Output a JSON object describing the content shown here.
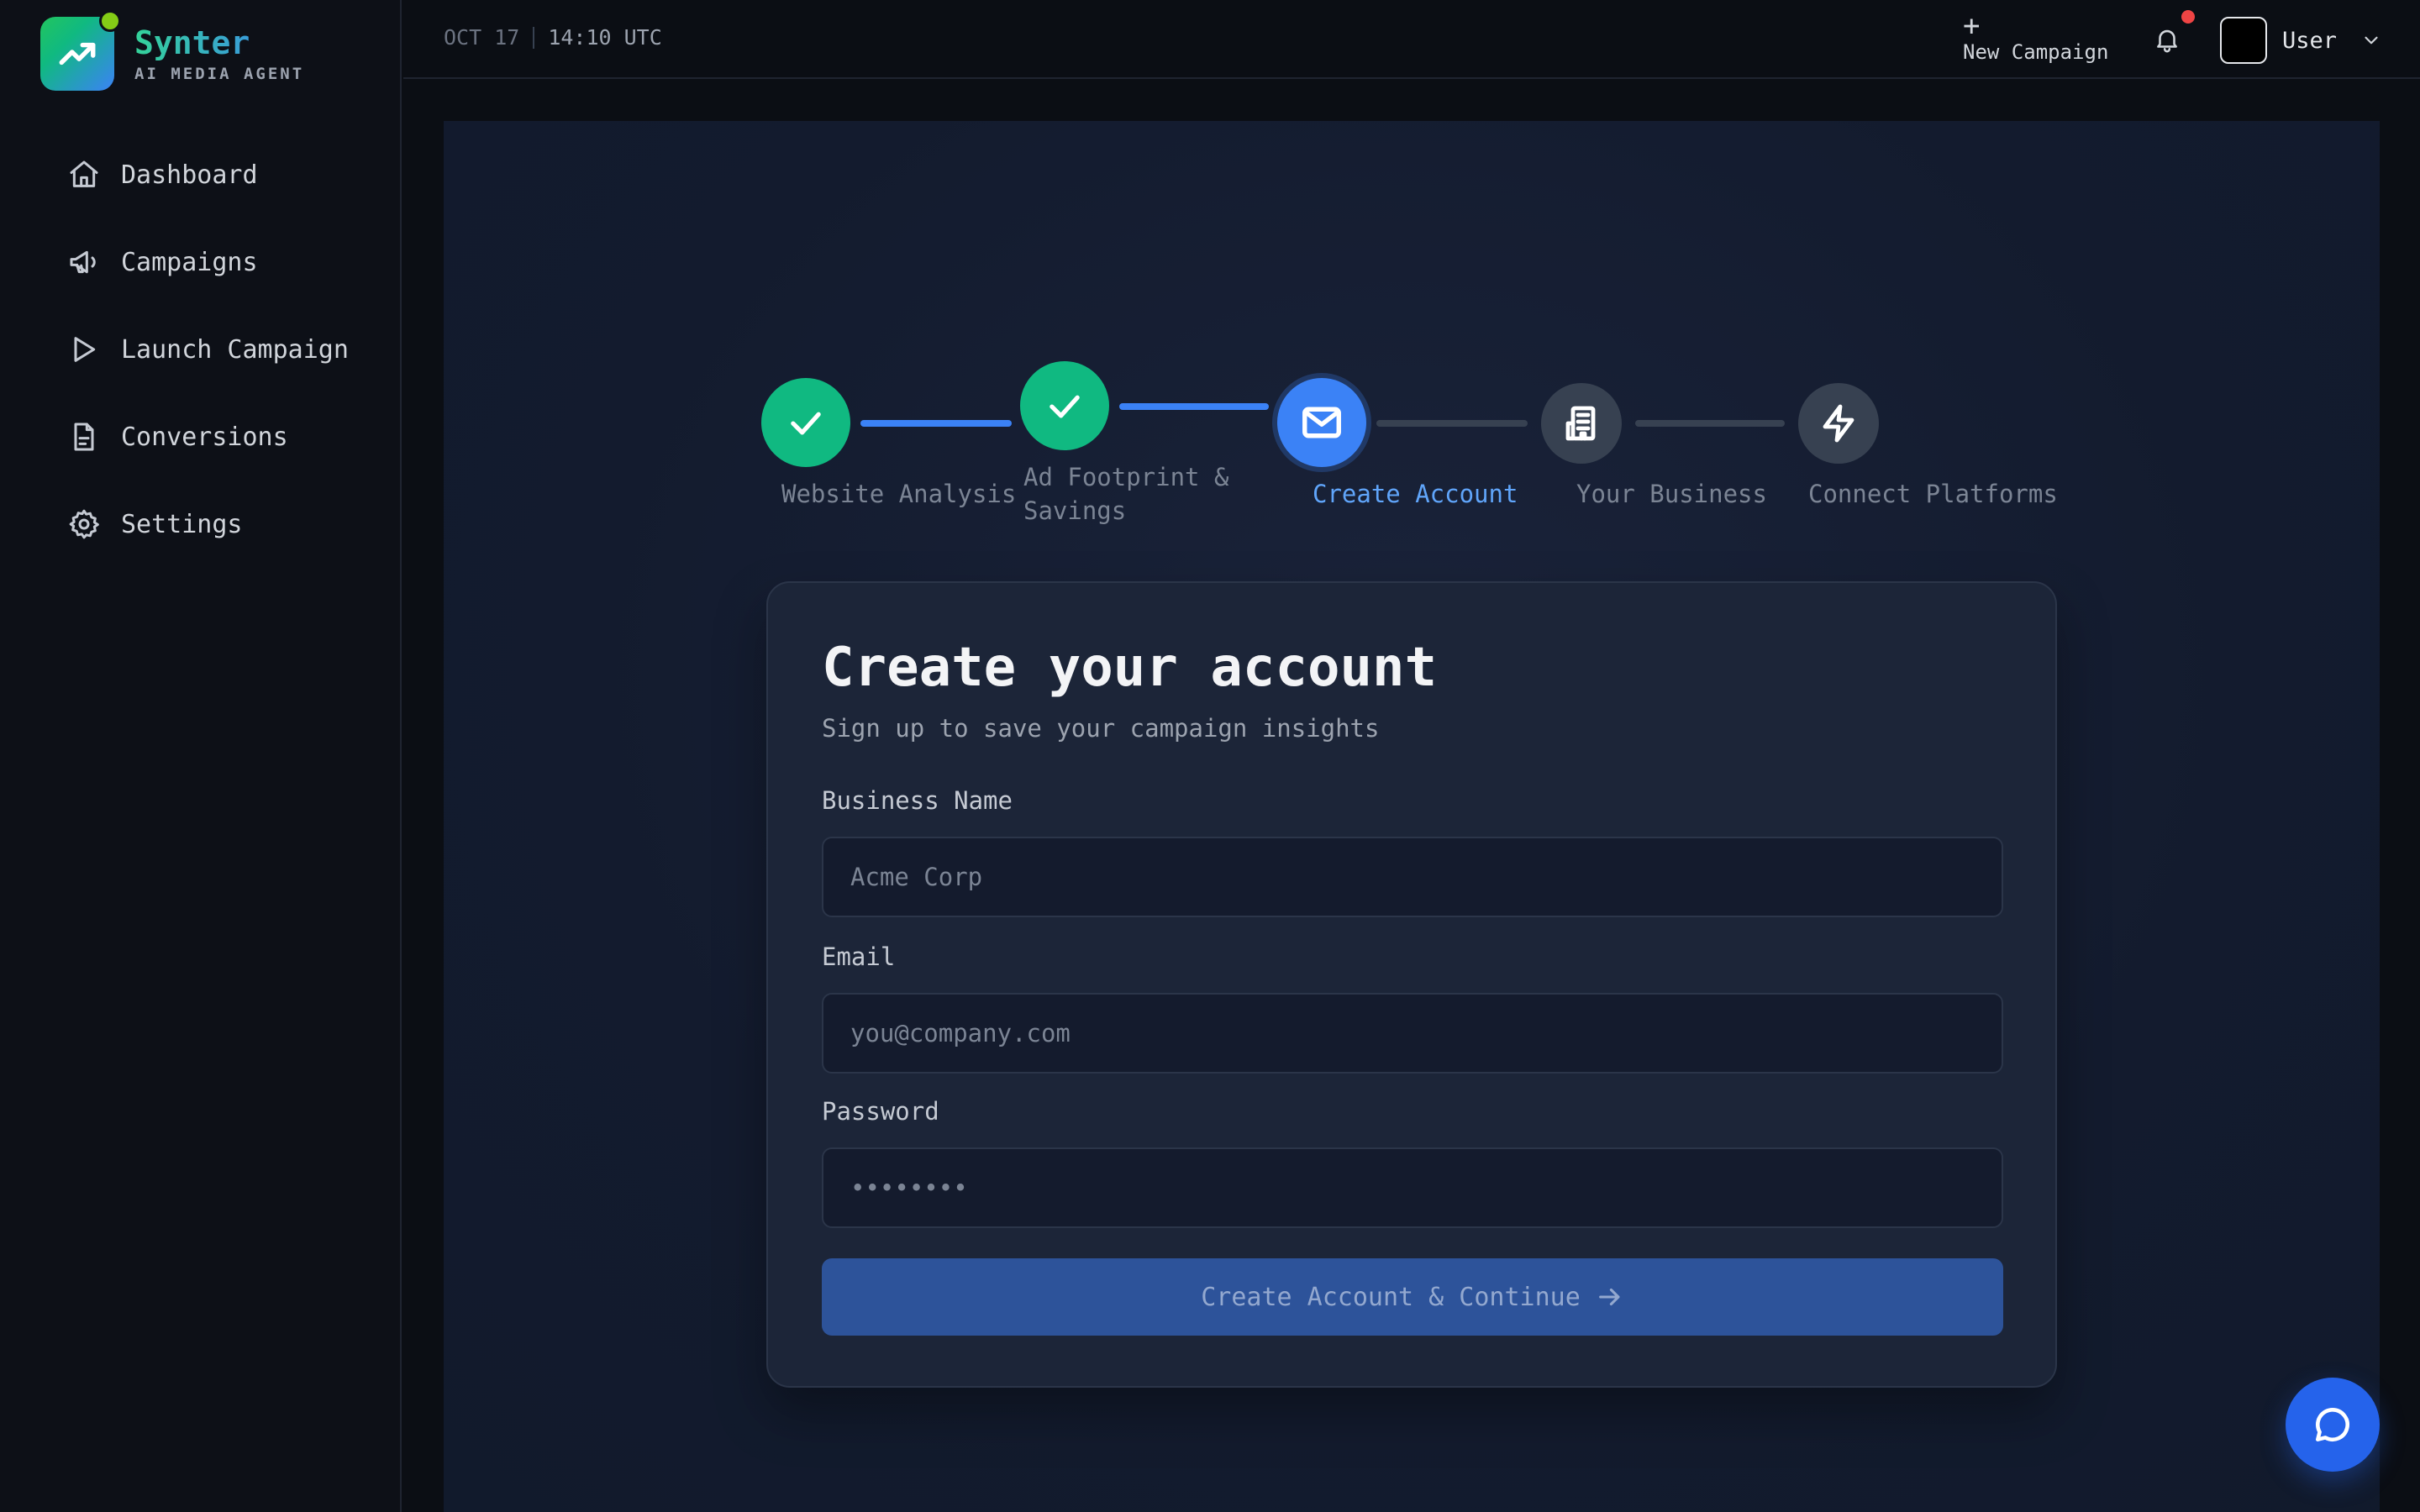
{
  "brand": {
    "name": "Synter",
    "tagline": "AI MEDIA AGENT",
    "logo_icon": "trending-up-icon",
    "accent_gradient": [
      "#22c55e",
      "#3b82f6"
    ]
  },
  "sidebar": {
    "items": [
      {
        "label": "Dashboard",
        "icon": "home-icon"
      },
      {
        "label": "Campaigns",
        "icon": "megaphone-icon"
      },
      {
        "label": "Launch Campaign",
        "icon": "play-icon"
      },
      {
        "label": "Conversions",
        "icon": "document-icon"
      },
      {
        "label": "Settings",
        "icon": "gear-icon"
      }
    ]
  },
  "topbar": {
    "date": "OCT 17",
    "time": "14:10 UTC",
    "new_campaign_label": "New Campaign",
    "user_label": "User",
    "notification_color": "#ef4444"
  },
  "stepper": {
    "steps": [
      {
        "label": "Website Analysis",
        "status": "done"
      },
      {
        "label": "Ad Footprint & Savings",
        "status": "done"
      },
      {
        "label": "Create Account",
        "status": "active"
      },
      {
        "label": "Your Business",
        "status": "pending"
      },
      {
        "label": "Connect Platforms",
        "status": "pending"
      }
    ],
    "colors": {
      "done": "#10b981",
      "active": "#3b82f6",
      "pending": "#374151"
    }
  },
  "form": {
    "title": "Create your account",
    "subtitle": "Sign up to save your campaign insights",
    "business": {
      "label": "Business Name",
      "placeholder": "Acme Corp",
      "value": ""
    },
    "email": {
      "label": "Email",
      "placeholder": "you@company.com",
      "value": ""
    },
    "password": {
      "label": "Password",
      "placeholder": "••••••••",
      "value": ""
    },
    "submit_label": "Create Account & Continue"
  }
}
